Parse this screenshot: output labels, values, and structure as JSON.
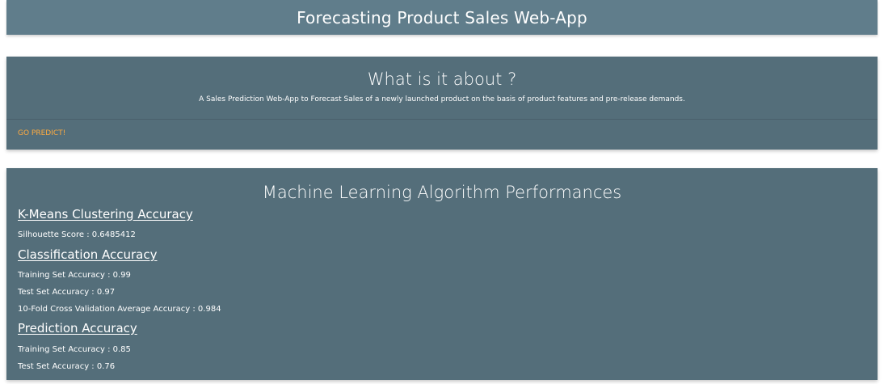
{
  "header": {
    "title": "Forecasting Product Sales Web-App"
  },
  "about": {
    "title": "What is it about ?",
    "description": "A Sales Prediction Web-App to Forecast Sales of a newly launched product on the basis of product features and pre-release demands.",
    "action_label": "GO PREDICT!"
  },
  "performance": {
    "title": "Machine Learning Algorithm Performances",
    "kmeans": {
      "heading": "K-Means Clustering Accuracy",
      "silhouette": "Silhouette Score : 0.6485412"
    },
    "classification": {
      "heading": "Classification Accuracy",
      "training": "Training Set Accuracy : 0.99",
      "test": "Test Set Accuracy : 0.97",
      "cross_validation": "10-Fold Cross Validation Average Accuracy : 0.984"
    },
    "prediction": {
      "heading": "Prediction Accuracy",
      "training": "Training Set Accuracy : 0.85",
      "test": "Test Set Accuracy : 0.76"
    }
  },
  "colors": {
    "header_bg": "#607d8b",
    "card_bg": "#546e7a",
    "accent": "#ffab40",
    "text": "#ffffff"
  }
}
